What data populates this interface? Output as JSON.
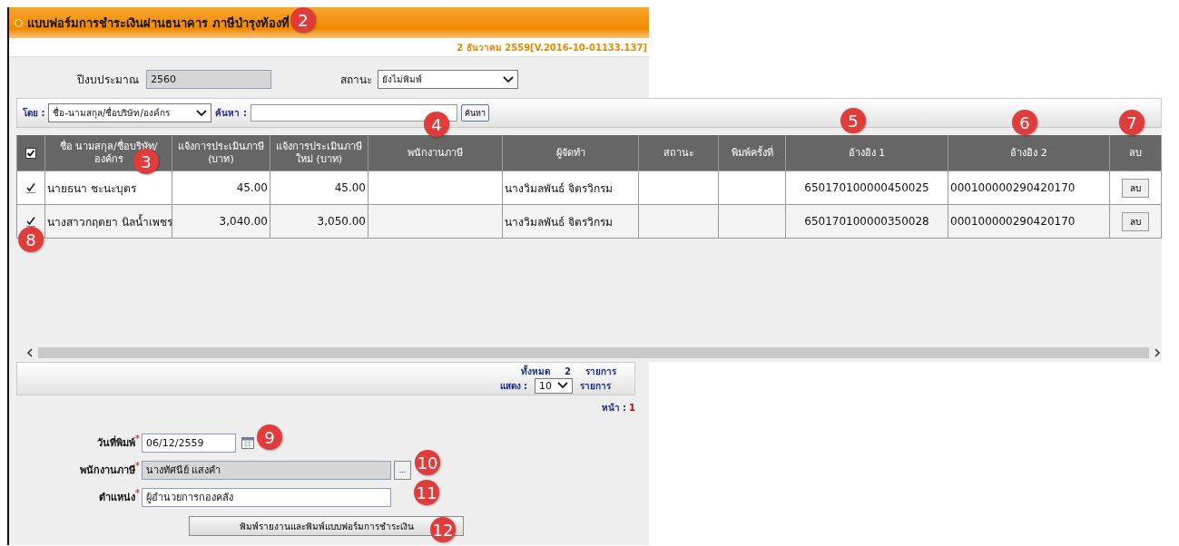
{
  "header": {
    "title": "แบบฟอร์มการชำระเงินผ่านธนาคาร ภาษีบำรุงท้องที่",
    "version": "2 ธันวาคม 2559[V.2016-10-01133.137]"
  },
  "filters": {
    "budget_label": "ปีงบประมาณ",
    "budget_value": "2560",
    "status_label": "สถานะ",
    "status_value": "ยังไม่พิมพ์"
  },
  "search": {
    "by_label": "โดย :",
    "by_value": "ชื่อ-นามสกุล/ชื่อบริษัท/องค์กร",
    "search_label": "ค้นหา :",
    "button": "ค้นหา"
  },
  "table": {
    "all_checked": true,
    "columns": [
      "ชื่อ นามสกุล/ชื่อบริษัท/องค์กร",
      "แจ้งการประเมินภาษี (บาท)",
      "แจ้งการประเมินภาษีใหม่ (บาท)",
      "พนักงานภาษี",
      "ผู้จัดทำ",
      "สถานะ",
      "พิมพ์ครั้งที่",
      "อ้างอิง 1",
      "อ้างอิง 2",
      "ลบ"
    ],
    "rows": [
      {
        "checked": true,
        "name": "นายธนา ชะนะบุตร",
        "tax": "45.00",
        "new_tax": "45.00",
        "preparer": "นางวิมลพันธ์ จิตรวิกรม",
        "ref1": "650170100000450025",
        "ref2": "000100000290420170",
        "delete": "ลบ"
      },
      {
        "checked": true,
        "name": "นางสาวกฤตยา นิลน้ำเพชร",
        "tax": "3,040.00",
        "new_tax": "3,050.00",
        "preparer": "นางวิมลพันธ์ จิตรวิกรม",
        "ref1": "650170100000350028",
        "ref2": "000100000290420170",
        "delete": "ลบ"
      }
    ]
  },
  "pagination": {
    "total_label": "ทั้งหมด",
    "total": "2",
    "total_unit": "รายการ",
    "show_label": "แสดง :",
    "page_size": "10",
    "page_size_unit": "รายการ",
    "page_label": "หน้า :",
    "page": "1"
  },
  "form": {
    "fields": [
      {
        "kind": "date",
        "label": "วันที่พิมพ์",
        "marker": "*",
        "value": "06/12/2559"
      },
      {
        "kind": "lookup",
        "label": "พนักงานภาษี",
        "marker": "*",
        "value": "นางทัศนีย์ แสงคำ",
        "lookup_button": "..."
      },
      {
        "kind": "text",
        "label": "ตำแหน่ง",
        "marker": "*",
        "value": "ผู้อำนวยการกองคลัง"
      }
    ],
    "submit": "พิมพ์รายงานและพิมพ์แบบฟอร์มการชำระเงิน"
  },
  "annotations": [
    "2",
    "3",
    "4",
    "5",
    "6",
    "7",
    "8",
    "9",
    "10",
    "11",
    "12"
  ]
}
